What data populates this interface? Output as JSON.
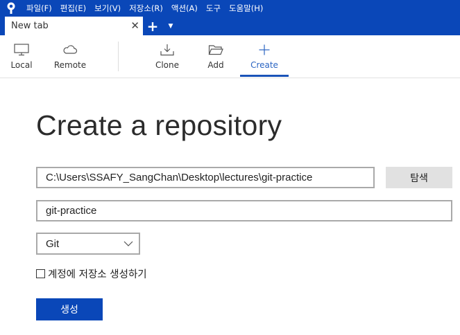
{
  "menu": {
    "items": [
      "파일(F)",
      "편집(E)",
      "보기(V)",
      "저장소(R)",
      "액션(A)",
      "도구",
      "도움말(H)"
    ]
  },
  "tabs": {
    "active_title": "New tab",
    "close_glyph": "✕",
    "add_glyph": "+",
    "dropdown_glyph": "▼"
  },
  "toolbar": {
    "local": "Local",
    "remote": "Remote",
    "clone": "Clone",
    "add": "Add",
    "create": "Create",
    "active": "Create"
  },
  "form": {
    "title": "Create a repository",
    "path_value": "C:\\Users\\SSAFY_SangChan\\Desktop\\lectures\\git-practice",
    "browse_label": "탐색",
    "name_value": "git-practice",
    "vcs_selected": "Git",
    "account_checkbox_label": "계정에 저장소 생성하기",
    "account_checkbox_checked": false,
    "create_label": "생성"
  },
  "colors": {
    "brand_blue": "#0a47b8",
    "active_accent": "#2a64c2",
    "field_border": "#a9a9a9",
    "secondary_button": "#e1e1e1"
  }
}
